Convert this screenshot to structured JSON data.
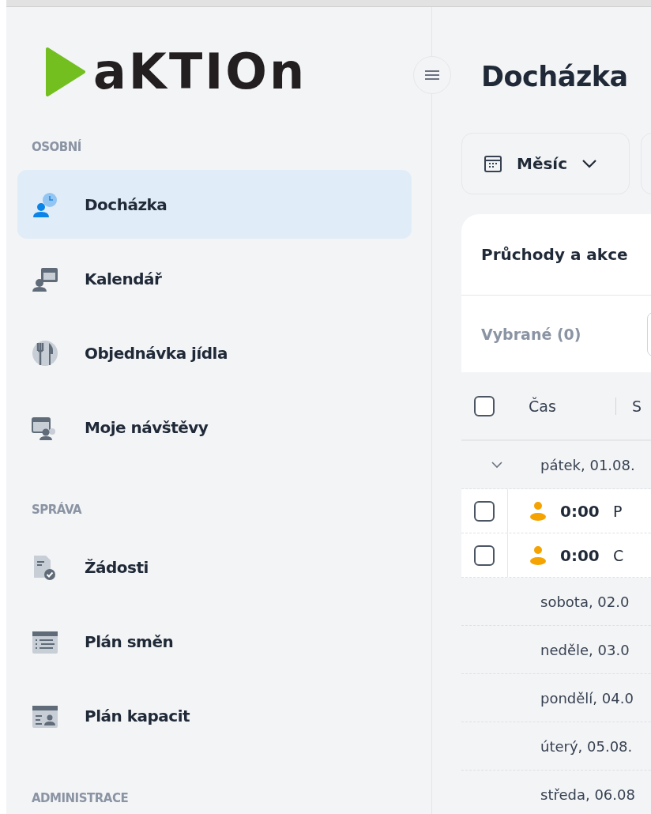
{
  "logo": {
    "text": "aKTIOn"
  },
  "sidebar": {
    "sections": [
      {
        "title": "OSOBNÍ",
        "items": [
          {
            "label": "Docházka",
            "selected": true
          },
          {
            "label": "Kalendář",
            "selected": false
          },
          {
            "label": "Objednávka jídla",
            "selected": false
          },
          {
            "label": "Moje návštěvy",
            "selected": false
          }
        ]
      },
      {
        "title": "SPRÁVA",
        "items": [
          {
            "label": "Žádosti",
            "selected": false
          },
          {
            "label": "Plán směn",
            "selected": false
          },
          {
            "label": "Plán kapacit",
            "selected": false
          }
        ]
      },
      {
        "title": "ADMINISTRACE"
      }
    ]
  },
  "page_title": "Docházka",
  "toolbar": {
    "period_button": "Měsíc"
  },
  "card": {
    "title": "Průchody a akce",
    "selected_count": "Vybrané (0)",
    "select_all_checked": false,
    "columns": [
      {
        "label": "Čas"
      },
      {
        "label": "S"
      }
    ],
    "groups": [
      {
        "label": "pátek, 01.08.",
        "expanded": true,
        "rows": [
          {
            "time": "0:00",
            "text": "P",
            "checked": false
          },
          {
            "time": "0:00",
            "text": "C",
            "checked": false
          }
        ]
      },
      {
        "label": "sobota, 02.0",
        "expanded": false
      },
      {
        "label": "neděle, 03.0",
        "expanded": false
      },
      {
        "label": "pondělí, 04.0",
        "expanded": false
      },
      {
        "label": "úterý, 05.08.",
        "expanded": false
      },
      {
        "label": "středa, 06.08",
        "expanded": false
      }
    ]
  }
}
